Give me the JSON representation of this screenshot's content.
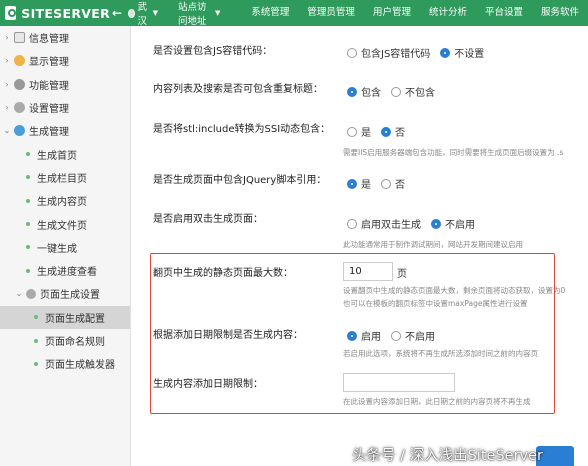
{
  "header": {
    "logo_text": "SITESERVER",
    "back": "←",
    "site_name": "武汉",
    "visit_site": "站点访问地址",
    "nav": [
      "系统管理",
      "管理员管理",
      "用户管理",
      "统计分析",
      "平台设置",
      "服务软件"
    ]
  },
  "sidebar": {
    "top_items": [
      {
        "label": "信息管理",
        "icon": "info-icon"
      },
      {
        "label": "显示管理",
        "icon": "display-icon"
      },
      {
        "label": "功能管理",
        "icon": "function-icon"
      },
      {
        "label": "设置管理",
        "icon": "gear-icon"
      },
      {
        "label": "生成管理",
        "icon": "generate-icon"
      }
    ],
    "gen_items": [
      "生成首页",
      "生成栏目页",
      "生成内容页",
      "生成文件页",
      "一键生成",
      "生成进度查看"
    ],
    "page_gen": "页面生成设置",
    "page_gen_items": [
      "页面生成配置",
      "页面命名规则",
      "页面生成触发器"
    ]
  },
  "form": {
    "q1": {
      "label": "是否设置包含JS容错代码：",
      "opt_a": "包含JS容错代码",
      "opt_b": "不设置",
      "selected": "opt_b"
    },
    "q2": {
      "label": "内容列表及搜索是否可包含重复标题：",
      "opt_a": "包含",
      "opt_b": "不包含",
      "selected": "opt_a"
    },
    "q3": {
      "label": "是否将stl:include转换为SSI动态包含：",
      "opt_a": "是",
      "opt_b": "否",
      "selected": "opt_b",
      "help": "需要IIS启用服务器端包含功能，同时需要将生成页面后缀设置为 .s"
    },
    "q4": {
      "label": "是否生成页面中包含JQuery脚本引用：",
      "opt_a": "是",
      "opt_b": "否",
      "selected": "opt_a"
    },
    "q5": {
      "label": "是否启用双击生成页面：",
      "opt_a": "启用双击生成",
      "opt_b": "不启用",
      "selected": "opt_b",
      "help": "此功能通常用于制作调试期间，网站开发期间建议启用"
    },
    "q6": {
      "label": "翻页中生成的静态页面最大数：",
      "value": "10",
      "unit": "页",
      "help1": "设置翻页中生成的静态页面最大数，剩余页面将动态获取，设置为0",
      "help2": "也可以在模板的翻页标签中设置maxPage属性进行设置"
    },
    "q7": {
      "label": "根据添加日期限制是否生成内容：",
      "opt_a": "启用",
      "opt_b": "不启用",
      "selected": "opt_a",
      "help": "若启用此选项，系统将不再生成所选添加时间之前的内容页"
    },
    "q8": {
      "label": "生成内容添加日期限制：",
      "value": "",
      "help": "在此设置内容添加日期，此日期之前的内容页将不再生成"
    }
  },
  "watermark": "头条号 / 深入浅出SiteServer",
  "colors": {
    "topbar": "#2e9a5c",
    "radio_on": "#2a7fd4",
    "highlight_box": "#e0463a"
  }
}
